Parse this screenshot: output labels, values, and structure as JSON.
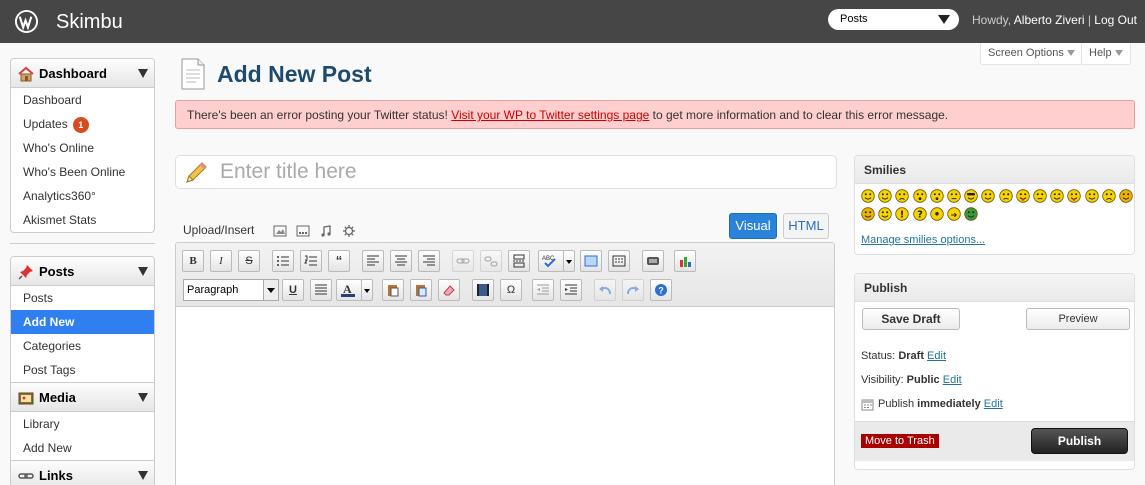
{
  "topbar": {
    "site_name": "Skimbu",
    "favorites_selected": "Posts",
    "howdy": "Howdy,",
    "user_name": "Alberto Ziveri",
    "separator": "|",
    "logout": "Log Out"
  },
  "screen_meta": {
    "screen_options": "Screen Options",
    "help": "Help"
  },
  "sidebar": {
    "dashboard": {
      "label": "Dashboard",
      "items": [
        "Dashboard",
        "Updates",
        "Who's Online",
        "Who's Been Online",
        "Analytics360°",
        "Akismet Stats"
      ],
      "updates_badge": "1"
    },
    "posts": {
      "label": "Posts",
      "items": [
        "Posts",
        "Add New",
        "Categories",
        "Post Tags"
      ]
    },
    "media": {
      "label": "Media",
      "items": [
        "Library",
        "Add New"
      ]
    },
    "links": {
      "label": "Links"
    }
  },
  "main": {
    "page_title": "Add New Post",
    "error": {
      "prefix": "There's been an error posting your Twitter status!",
      "link": "Visit your WP to Twitter settings page",
      "suffix": "to get more information and to clear this error message."
    },
    "title_placeholder": "Enter title here",
    "upload_insert": "Upload/Insert",
    "tabs": {
      "visual": "Visual",
      "html": "HTML"
    },
    "toolbar": {
      "bold": "B",
      "italic": "I",
      "strike": "S",
      "format_selected": "Paragraph",
      "underline": "U",
      "omega": "Ω"
    }
  },
  "smilies_panel": {
    "title": "Smilies",
    "manage_link": "Manage smilies options..."
  },
  "publish_panel": {
    "title": "Publish",
    "save_draft": "Save Draft",
    "preview": "Preview",
    "status_label": "Status:",
    "status_value": "Draft",
    "visibility_label": "Visibility:",
    "visibility_value": "Public",
    "publish_label": "Publish",
    "publish_value": "immediately",
    "edit": "Edit",
    "move_to_trash": "Move to Trash",
    "publish_button": "Publish"
  },
  "colors": {
    "topbar_bg": "#464646",
    "current_menu": "#2f7ff0",
    "error_bg": "#ffcfcf",
    "visual_tab": "#2b82d9",
    "trash_bg": "#aa0000"
  }
}
